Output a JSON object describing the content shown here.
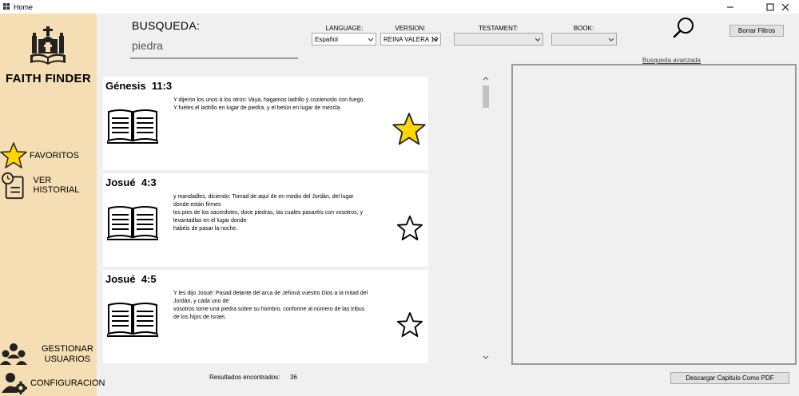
{
  "window": {
    "title": "Home"
  },
  "sidebar": {
    "brand": "FAITH FINDER",
    "items": [
      {
        "label": "FAVORITOS",
        "icon": "star-icon"
      },
      {
        "label": "VER HISTORIAL",
        "icon": "history-icon"
      },
      {
        "label": "GESTIONAR\nUSUARIOS",
        "icon": "users-icon"
      },
      {
        "label": "CONFIGURACION",
        "icon": "user-settings-icon"
      }
    ]
  },
  "search": {
    "label": "BUSQUEDA:",
    "value": "piedra"
  },
  "filters": {
    "language": {
      "label": "LANGUAGE:",
      "value": "Español"
    },
    "version": {
      "label": "VERSION:",
      "value": "REINA VALERA 19"
    },
    "testament": {
      "label": "TESTAMENT:",
      "value": ""
    },
    "book": {
      "label": "BOOK:",
      "value": ""
    }
  },
  "buttons": {
    "clear_filters": "Borrar Filtros",
    "advanced_search": "Busqueda avanzada",
    "download_pdf": "Descargar Capitulo Como PDF"
  },
  "results": [
    {
      "book": "Génesis",
      "chapter_verse": "11:3",
      "lines": [
        "Y dijeron los unos á los otros: Vaya, hagamos ladrillo y cozámoslo con fuego.",
        "Y fuéles el ladrillo en lugar de piedra, y el betún en lugar de mezcla."
      ],
      "favorite": true
    },
    {
      "book": "Josué",
      "chapter_verse": "4:3",
      "lines": [
        "y mandadles, diciendo: Tomad de aquí de en medio del Jordán, del lugar",
        "donde están firmes",
        "los pies de los sacerdotes, doce piedras, las cuales pasaréis con vosotros, y",
        "levantadlas en el lugar donde",
        "habéis de pasar la noche."
      ],
      "favorite": false
    },
    {
      "book": "Josué",
      "chapter_verse": "4:5",
      "lines": [
        "Y les dijo Josué: Pasad delante del arca de Jehová vuestro Dios a la mitad del",
        "Jordán, y cada uno de",
        "vosotros tome una piedra sobre su hombro, conforme al número de las tribus",
        "de los hijos de Israel,"
      ],
      "favorite": false
    }
  ],
  "results_count": {
    "label": "Resultados encontrados:",
    "value": "36"
  },
  "colors": {
    "sidebar": "#f5deb3",
    "star_fill": "#ffd700",
    "background": "#f0f0f0"
  }
}
